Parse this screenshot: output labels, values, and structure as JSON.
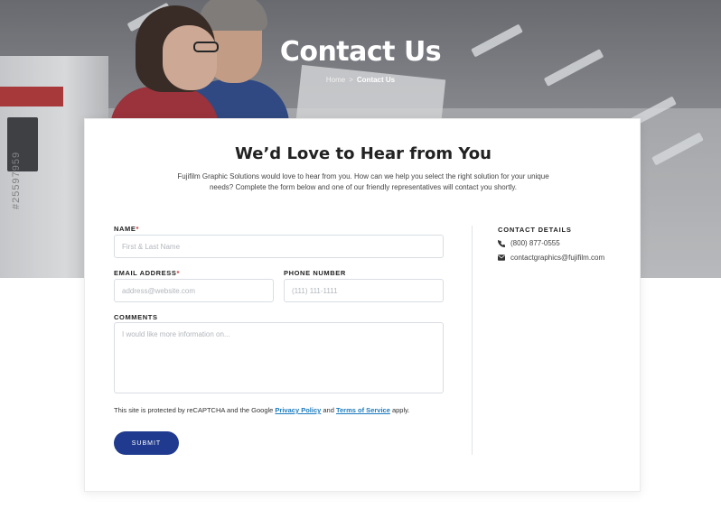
{
  "hero": {
    "title": "Contact Us",
    "stamp": "#25597959",
    "breadcrumb": {
      "home": "Home",
      "separator": ">",
      "current": "Contact Us"
    }
  },
  "form_card": {
    "heading": "We’d Love to Hear from You",
    "intro": "Fujifilm Graphic Solutions would love to hear from you. How can we help you select the right solution for your unique needs? Complete the form below and one of our friendly representatives will contact you shortly.",
    "fields": {
      "name": {
        "label": "NAME",
        "required_mark": "*",
        "placeholder": "First & Last Name",
        "value": ""
      },
      "email": {
        "label": "EMAIL ADDRESS",
        "required_mark": "*",
        "placeholder": "address@website.com",
        "value": ""
      },
      "phone": {
        "label": "PHONE NUMBER",
        "placeholder": "(111) 111-1111",
        "value": ""
      },
      "comments": {
        "label": "COMMENTS",
        "placeholder": "I would like more information on...",
        "value": ""
      }
    },
    "recaptcha": {
      "prefix": "This site is protected by reCAPTCHA and the Google ",
      "privacy_link": "Privacy Policy",
      "middle": " and ",
      "terms_link": "Terms of Service",
      "suffix": " apply."
    },
    "submit_label": "SUBMIT"
  },
  "contact_details": {
    "title": "CONTACT DETAILS",
    "phone": "(800) 877-0555",
    "email": "contactgraphics@fujifilm.com",
    "icons": [
      "phone-icon",
      "envelope-icon"
    ]
  },
  "colors": {
    "submit_button": "#1f3a8e",
    "link": "#1c7bbd",
    "required": "#d0342c"
  }
}
